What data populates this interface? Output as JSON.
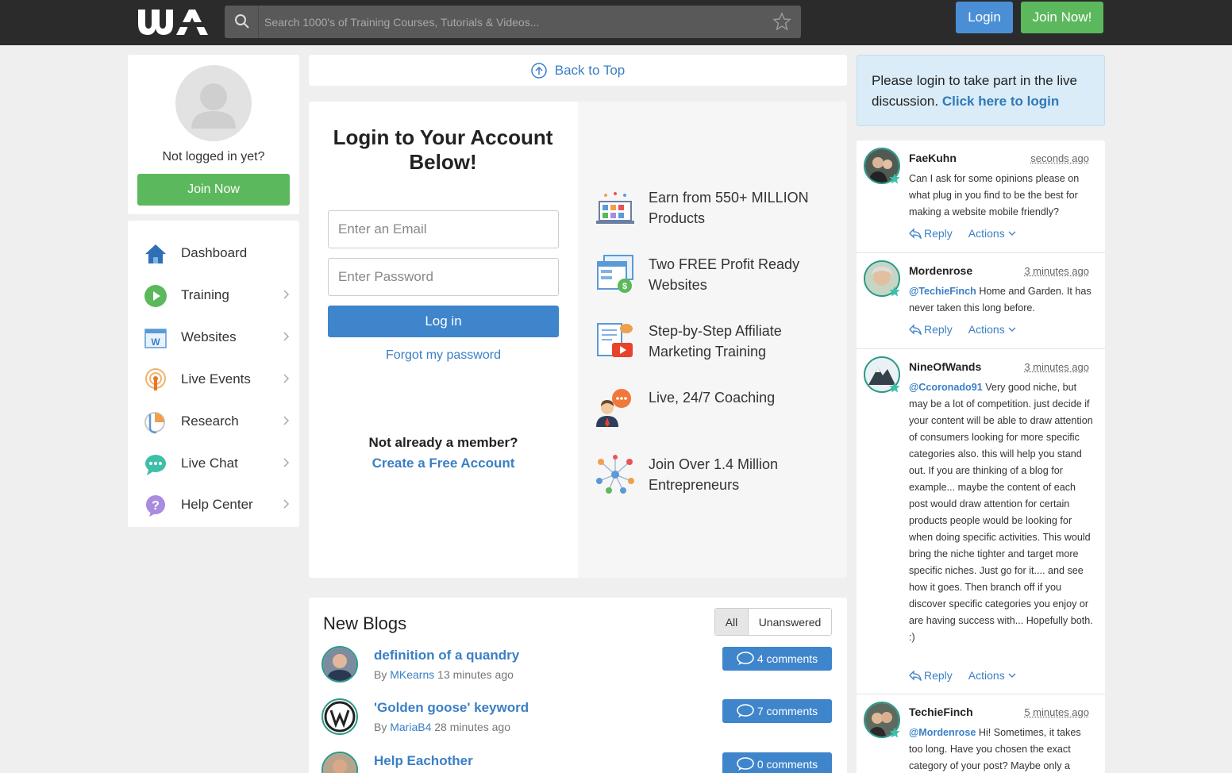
{
  "header": {
    "search_placeholder": "Search 1000's of Training Courses, Tutorials & Videos...",
    "login_label": "Login",
    "join_label": "Join Now!"
  },
  "profile": {
    "not_logged_text": "Not logged in yet?",
    "join_button": "Join Now"
  },
  "nav": {
    "items": [
      {
        "label": "Dashboard",
        "icon": "home-icon"
      },
      {
        "label": "Training",
        "icon": "play-icon"
      },
      {
        "label": "Websites",
        "icon": "website-icon"
      },
      {
        "label": "Live Events",
        "icon": "live-events-icon"
      },
      {
        "label": "Research",
        "icon": "research-icon"
      },
      {
        "label": "Live Chat",
        "icon": "chat-icon"
      },
      {
        "label": "Help Center",
        "icon": "help-icon"
      }
    ]
  },
  "back_to_top": "Back to Top",
  "login": {
    "title": "Login to Your Account Below!",
    "email_placeholder": "Enter an Email",
    "password_placeholder": "Enter Password",
    "login_button": "Log in",
    "forgot": "Forgot my password",
    "member_question": "Not already a member?",
    "create_account": "Create a Free Account"
  },
  "features": [
    {
      "text": "Earn from 550+ MILLION Products",
      "icon": "products-icon"
    },
    {
      "text": "Two FREE Profit Ready Websites",
      "icon": "websites-icon"
    },
    {
      "text": "Step-by-Step Affiliate Marketing Training",
      "icon": "training-icon"
    },
    {
      "text": "Live, 24/7 Coaching",
      "icon": "coaching-icon"
    },
    {
      "text": "Join Over 1.4 Million Entrepreneurs",
      "icon": "network-icon"
    }
  ],
  "blogs": {
    "title": "New Blogs",
    "filter_all": "All",
    "filter_unanswered": "Unanswered",
    "by_label": "By",
    "items": [
      {
        "title": "definition of a quandry",
        "author": "MKearns",
        "time": "13 minutes ago",
        "comments": "4 comments"
      },
      {
        "title": "'Golden goose' keyword",
        "author": "MariaB4",
        "time": "28 minutes ago",
        "comments": "7 comments"
      },
      {
        "title": "Help Eachother",
        "author": "",
        "time": "",
        "comments": "0 comments"
      }
    ]
  },
  "notice": {
    "text": "Please login to take part in the live discussion.",
    "link": "Click here to login"
  },
  "chat": {
    "reply_label": "Reply",
    "actions_label": "Actions",
    "messages": [
      {
        "name": "FaeKuhn",
        "time": "seconds ago",
        "mention": "",
        "text": "Can I ask for some opinions please on what plug in you find to be the best for making a website mobile friendly?"
      },
      {
        "name": "Mordenrose",
        "time": "3 minutes ago",
        "mention": "@TechieFinch",
        "text": " Home and Garden. It has never taken this long before."
      },
      {
        "name": "NineOfWands",
        "time": "3 minutes ago",
        "mention": "@Ccoronado91",
        "text": " Very good niche, but may be a lot of competition. just decide if your content will be able to draw attention of consumers looking for more specific categories also. this will help you stand out. If you are thinking of a blog for example... maybe the content of each post would draw attention for certain products people would be looking for when doing specific activities. This would bring the niche tighter and target more specific niches. Just go for it.... and see how it goes. Then branch off if you discover specific categories you enjoy or are having success with... Hopefully both. :)"
      },
      {
        "name": "TechieFinch",
        "time": "5 minutes ago",
        "mention": "@Mordenrose",
        "text": " Hi! Sometimes, it takes too long. Have you chosen the exact category of your post? Maybe only a"
      }
    ]
  }
}
